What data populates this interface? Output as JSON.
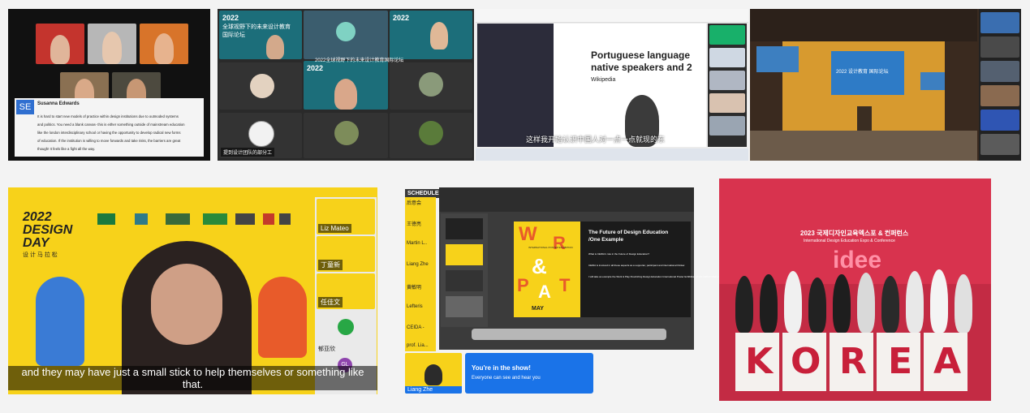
{
  "panel1": {
    "avatar_initials": "SE",
    "speaker_name": "Susanna Edwards",
    "quote_lines": [
      "It is hard to start new models of practice within design institutions due to outmoded systems",
      "and politics. You need a blank canvas- this is either something outside of mainstream education",
      "like the london interdisciplinary school or having the opportunity to develop radical new forms",
      "of education. If the institution is willing to move forwards and take risks, the barriers are great",
      "though! It feels like a fight all the way."
    ]
  },
  "panel2": {
    "banner_year": "2022",
    "banner_title_1": "全球视野下的未来设计教育",
    "banner_title_2": "国际论坛",
    "mid_banner": "2022全球视野下的未来设计教育国际论坛",
    "bottom_caption": "提到设计团队的部分工"
  },
  "panel3": {
    "slide_title_1": "Portuguese language",
    "slide_title_2": "native speakers and 2",
    "slide_source": "Wikipedia",
    "subtitle": "这样我开始认识中国人对一点一点就现的东"
  },
  "panel4": {
    "screen_title": "2022 设计教育 国际论坛"
  },
  "panel5": {
    "title_line1": "2022",
    "title_line2": "DESIGN",
    "title_line3": "DAY",
    "title_cn": "设 计 马 拉 松",
    "participant_names": [
      "Liz Mateo",
      "丁童新",
      "任佳文"
    ],
    "side_label": "郁亚欣",
    "gl_initials": "GL",
    "caption_line1": "and they may have just a small stick to help themselves or something like",
    "caption_line2": "that."
  },
  "panel6": {
    "badge": "SCHEDULED",
    "left_names": [
      "后意会",
      "王徳亮",
      "Martin L..",
      "Liang Zhe",
      "黄敏明",
      "Lefteris",
      "CEIDA -",
      "prof. Lia..."
    ],
    "slide_heading_1": "The Future of Design Education",
    "slide_heading_2": "/One Example",
    "slide_question": "What is CEIDA's role in the Future of Design Education?",
    "slide_body_1": "CEIDA is involved in all these aspects as a supporter, participant and international thinker.",
    "slide_body_2": "I will take as example the Work & Play Flourishing Design Education International Poster Exhibition which CEIDA collaborated with TEAM, University of Siena/Seoul and Jiao University/China in May 2022.",
    "poster_words": [
      "W",
      "R",
      "&",
      "P",
      "A",
      "T"
    ],
    "poster_small": "INTERNATIONAL POSTER EXHIBITION",
    "poster_date": "MAY",
    "self_name": "Liang Zhe",
    "notice_title": "You're in the show!",
    "notice_body": "Everyone can see and hear you"
  },
  "panel7": {
    "banner_kr": "2023 국제디자인교육엑스포 & 컨퍼런스",
    "banner_en": "International Design Education Expo & Conference",
    "logo_text": "idee",
    "korea_letters": [
      "K",
      "O",
      "R",
      "E",
      "A"
    ]
  },
  "colors": {
    "yellow": "#f7d21a",
    "zoom_dark": "#1e1e1e",
    "meet_blue": "#1a73e8",
    "korea_red": "#c8203a"
  }
}
